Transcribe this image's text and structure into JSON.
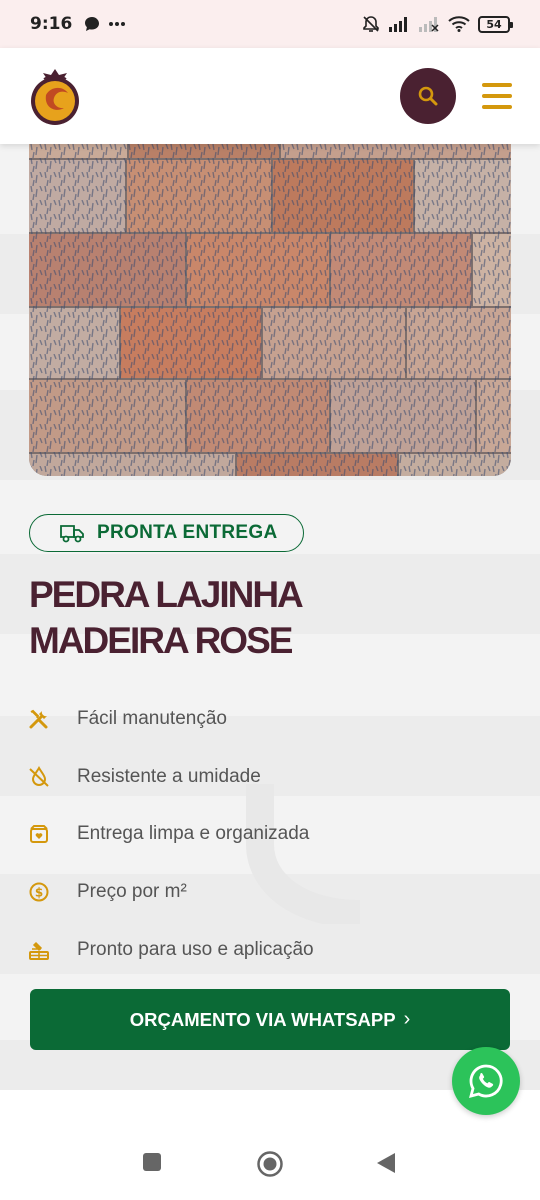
{
  "status_bar": {
    "time": "9:16",
    "battery": "54",
    "icons": [
      "chat-bubble-icon",
      "more-dots-icon",
      "mute-bell-icon",
      "signal-icon",
      "signal-weak-icon",
      "wifi-icon",
      "battery-icon"
    ]
  },
  "header": {
    "logo": "brand-logo",
    "search_icon": "search-icon",
    "menu_icon": "hamburger-menu-icon"
  },
  "product": {
    "badge": "PRONTA ENTREGA",
    "title_line1": "PEDRA LAJINHA",
    "title_line2": "MADEIRA ROSE",
    "features": [
      {
        "icon": "tools-icon",
        "label": "Fácil manutenção"
      },
      {
        "icon": "no-water-drop-icon",
        "label": "Resistente a umidade"
      },
      {
        "icon": "package-heart-icon",
        "label": "Entrega limpa e organizada"
      },
      {
        "icon": "dollar-coin-icon",
        "label": "Preço por m²"
      },
      {
        "icon": "ready-tools-icon",
        "label": "Pronto para uso e aplicação"
      }
    ],
    "cta": "ORÇAMENTO VIA WHATSAPP",
    "cta_chevron": "›"
  },
  "colors": {
    "brand_wine": "#4a2131",
    "brand_gold": "#d4980d",
    "brand_green": "#0b6a36",
    "whatsapp_green": "#2cc35a"
  },
  "nav_bar": {
    "icons": [
      "recent-apps-icon",
      "home-icon",
      "back-icon"
    ]
  }
}
